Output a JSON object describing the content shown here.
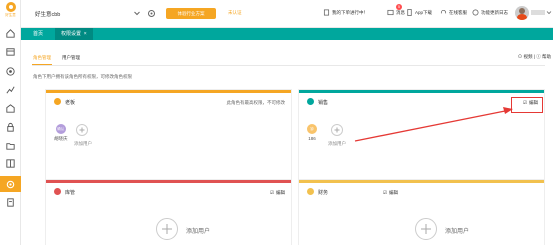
{
  "sidebar": {
    "logo_text": "好生意",
    "icons": [
      "home-icon",
      "calendar-icon",
      "target-icon",
      "chart-icon",
      "house-icon",
      "lock-icon",
      "folder-icon",
      "grid-icon",
      "settings-icon",
      "document-icon"
    ]
  },
  "topbar": {
    "company": "好生意cbb",
    "org_button": "体验行业方案",
    "unverified": "未认证",
    "todo": "我的下单进行中！",
    "messages": "消息",
    "message_count": "5",
    "app_download": "App下载",
    "online_service": "在线客服",
    "updates": "功能更新日志"
  },
  "tabs": {
    "home": "首页",
    "permission": "权限设置"
  },
  "subtabs": {
    "role_management": "角色管理",
    "user_management": "用户管理"
  },
  "toolbar": {
    "video": "视频",
    "help": "帮助"
  },
  "description": "角色下用户拥有该角色所有权限，可修改角色权限",
  "cards": {
    "boss": {
      "title": "老板",
      "note": "此角色有最高权限，不可修改",
      "member_avatar": "确认",
      "member_name": "胡晓庆",
      "add_label": "添加用户"
    },
    "sales": {
      "title": "销售",
      "edit_label": "编辑",
      "member_avatar": "钟",
      "member_name": "186",
      "add_label": "添加用户"
    },
    "warehouse": {
      "title": "库管",
      "edit_label": "编辑",
      "add_label": "添加用户"
    },
    "finance": {
      "title": "财务",
      "edit_label": "编辑",
      "add_label": "添加用户"
    }
  },
  "colors": {
    "accent": "#f5a623",
    "teal": "#00a79d",
    "red": "#e53935",
    "warehouse_stripe": "#e05252",
    "finance_stripe": "#f2c14e"
  }
}
